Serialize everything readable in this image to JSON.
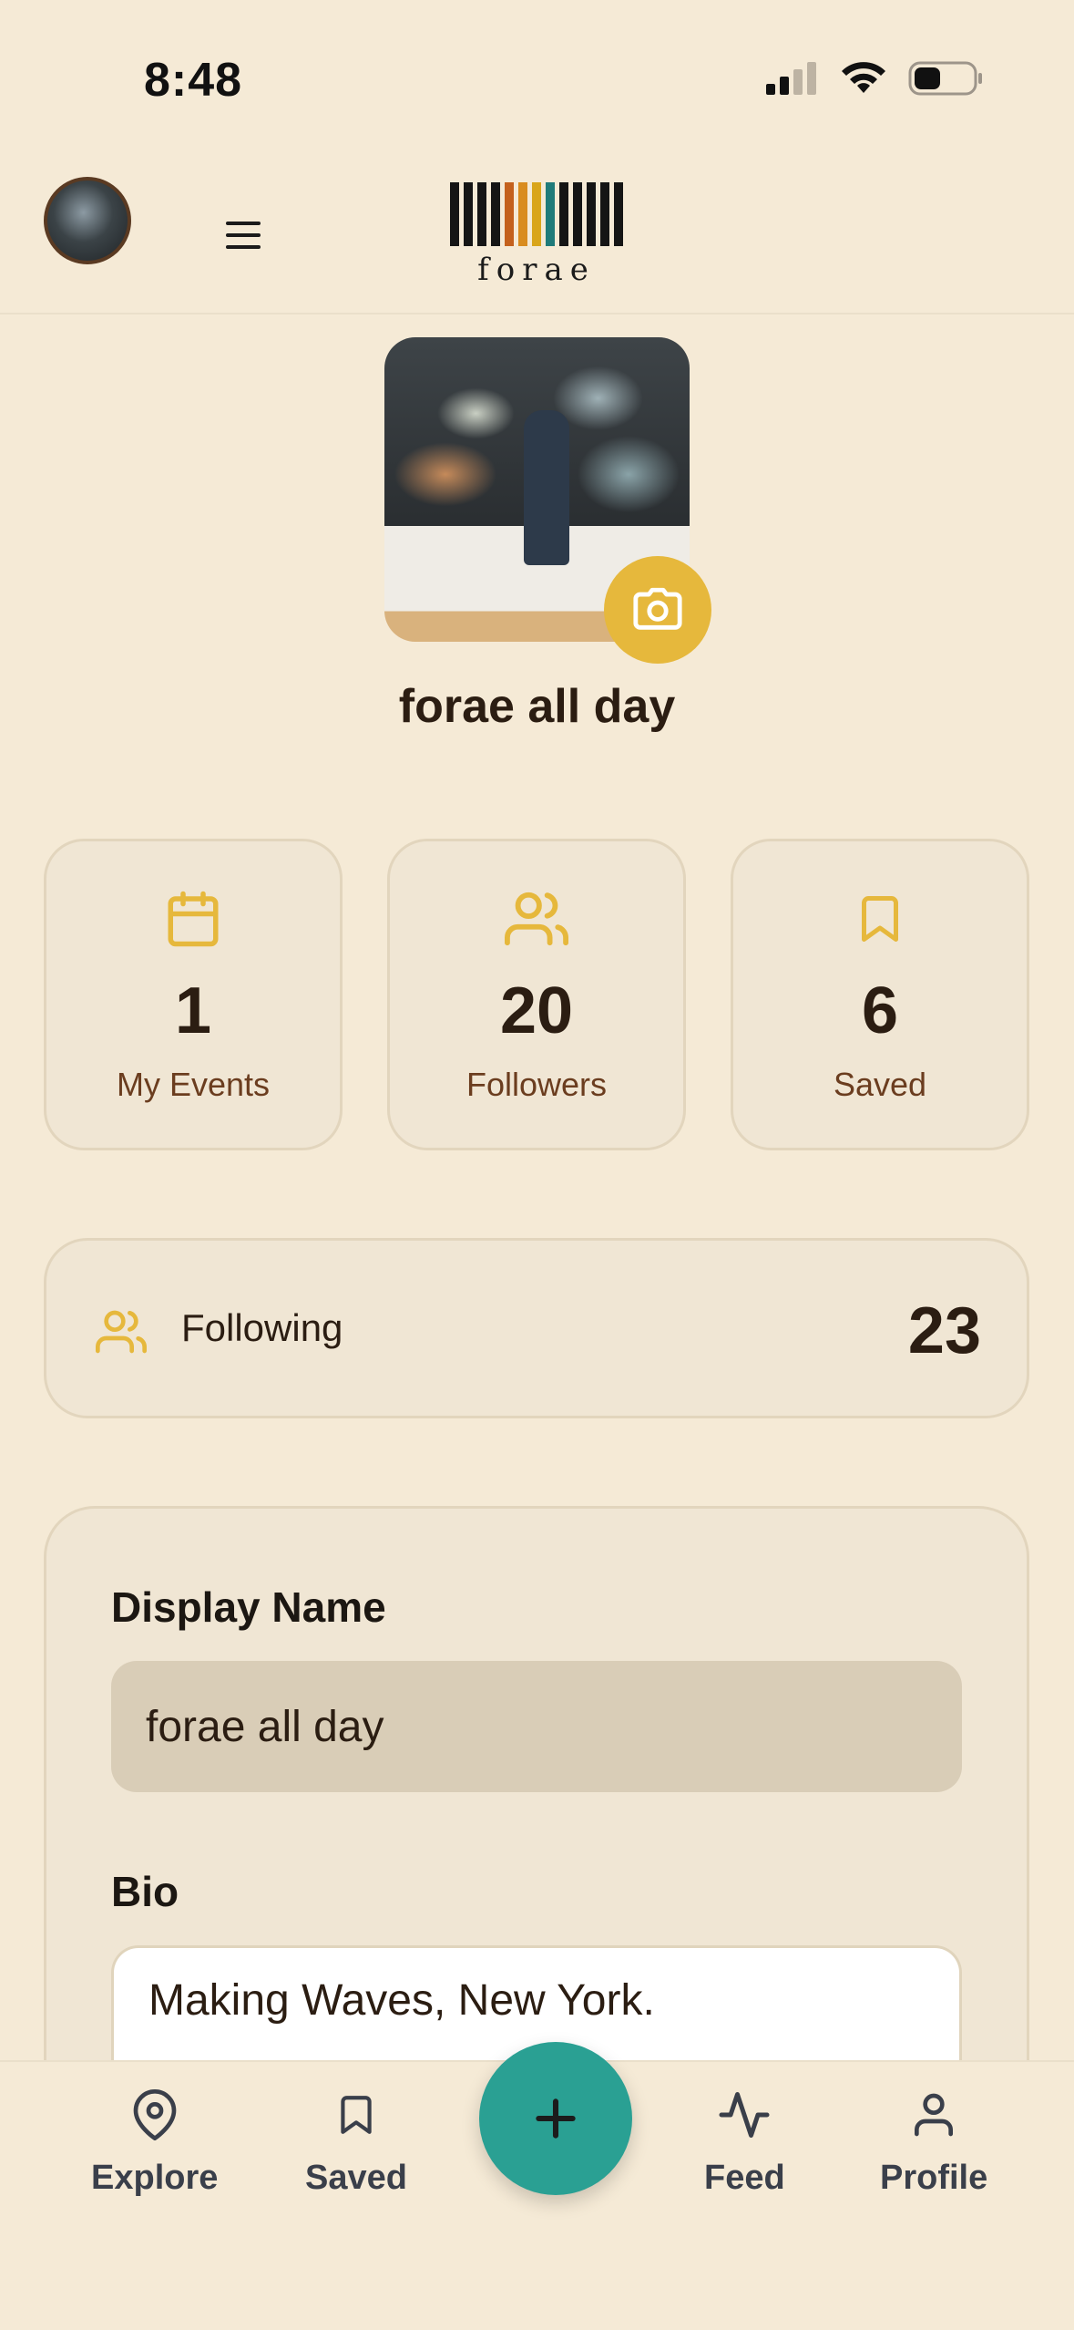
{
  "status_bar": {
    "time": "8:48"
  },
  "header": {
    "logo_text": "forae",
    "logo_colors": [
      "#151515",
      "#151515",
      "#151515",
      "#151515",
      "#c4611d",
      "#d98c1f",
      "#d9a51a",
      "#1f7b7a",
      "#151515",
      "#151515",
      "#151515",
      "#151515",
      "#151515"
    ]
  },
  "profile": {
    "name": "forae all day"
  },
  "stats": [
    {
      "icon": "calendar-icon",
      "value": "1",
      "label": "My Events"
    },
    {
      "icon": "users-icon",
      "value": "20",
      "label": "Followers"
    },
    {
      "icon": "bookmark-icon",
      "value": "6",
      "label": "Saved"
    }
  ],
  "following": {
    "label": "Following",
    "value": "23"
  },
  "form": {
    "display_name_label": "Display Name",
    "display_name_value": "forae all day",
    "bio_label": "Bio",
    "bio_value": "Making Waves, New York."
  },
  "nav": {
    "explore": "Explore",
    "saved": "Saved",
    "feed": "Feed",
    "profile": "Profile"
  },
  "colors": {
    "accent": "#e6b83c",
    "fab": "#2aa093",
    "background": "#f5ead6"
  }
}
